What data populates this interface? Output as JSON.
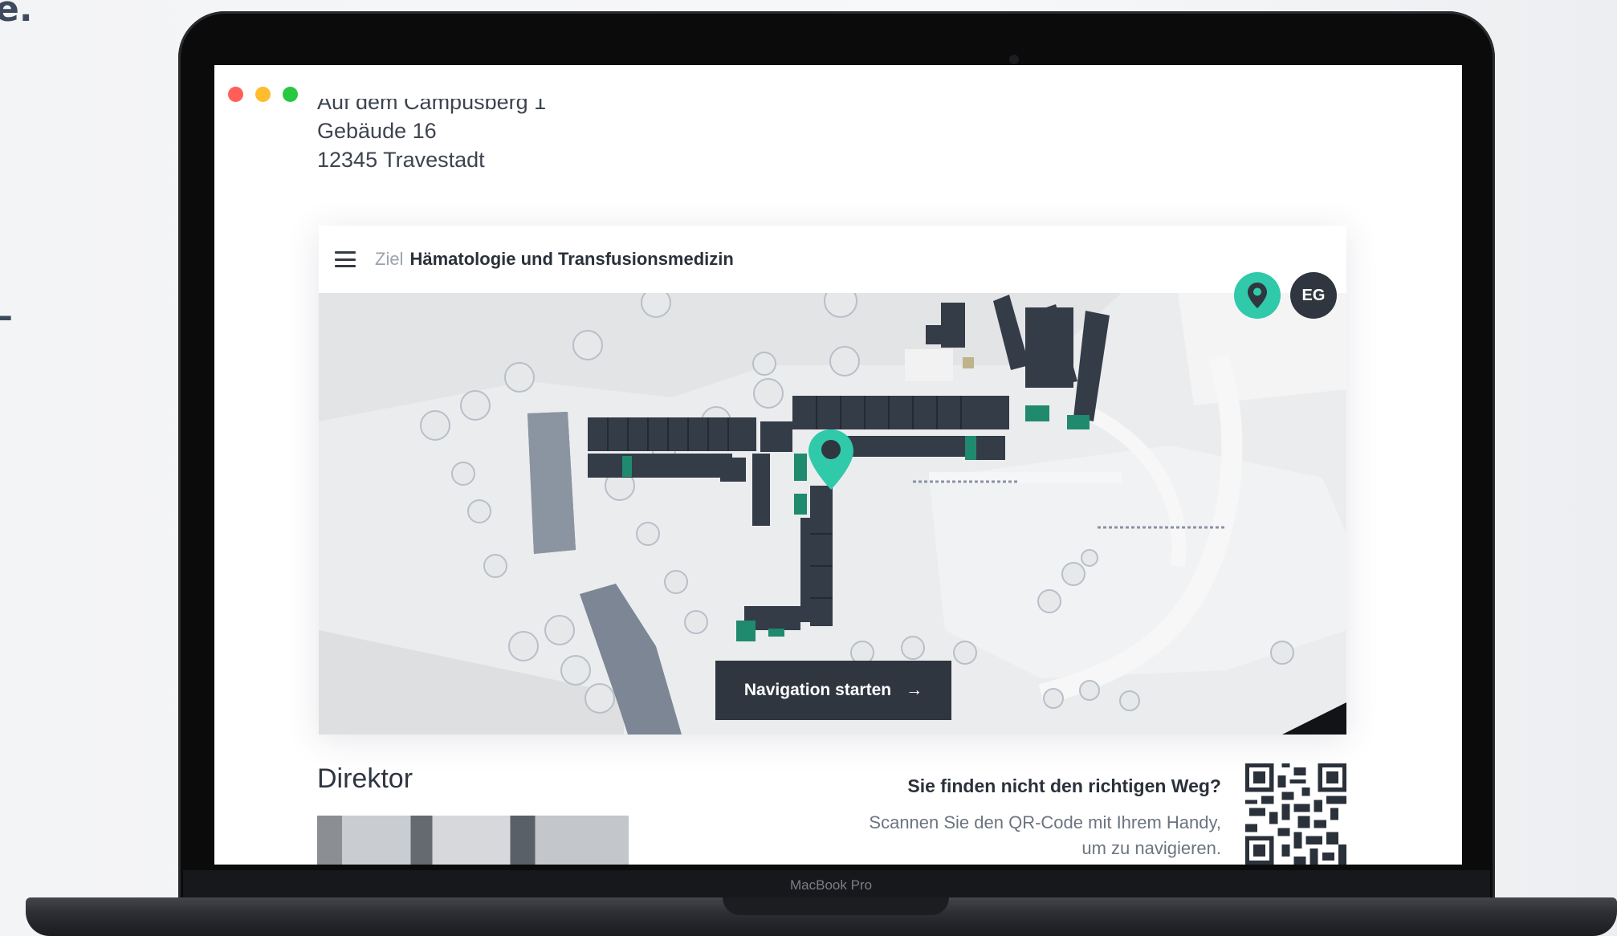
{
  "background_edge": {
    "glyph_top": "e.",
    "glyph_mid": "–"
  },
  "window": {
    "traffic_lights": [
      "#ff5f57",
      "#febc2e",
      "#28c840"
    ]
  },
  "address": {
    "line1_partial": "Auf dem Campusberg 1",
    "line2": "Gebäude 16",
    "line3": "12345 Travestadt"
  },
  "destination_bar": {
    "menu_icon": "hamburger-menu-icon",
    "label": "Ziel",
    "value": "Hämatologie und Transfusionsmedizin"
  },
  "map": {
    "location_button_icon": "location-pin-icon",
    "floor_label": "EG",
    "pin_color": "#30c9aa",
    "building_color": "#333b47",
    "highlight_room_color": "#1f8a6e",
    "navigate_button": {
      "label": "Navigation starten",
      "arrow": "→"
    }
  },
  "director": {
    "title": "Direktor"
  },
  "help": {
    "title": "Sie finden nicht den richtigen Weg?",
    "line1": "Scannen Sie den QR-Code mit Ihrem Handy,",
    "line2": "um zu navigieren."
  },
  "laptop": {
    "model_label": "MacBook Pro"
  }
}
